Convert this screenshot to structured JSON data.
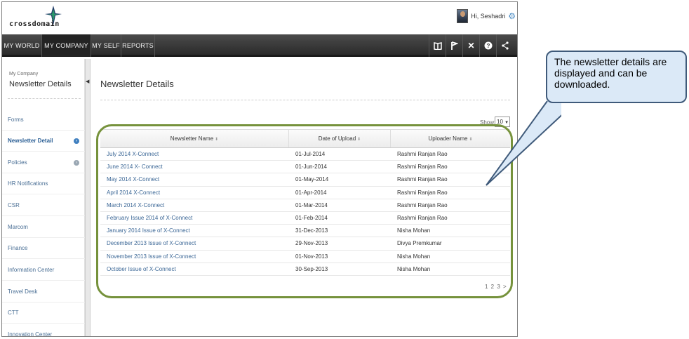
{
  "header": {
    "logo_text": "crossdomain",
    "greeting": "Hi, Seshadri"
  },
  "nav": {
    "items": [
      {
        "label": "MY WORLD"
      },
      {
        "label": "MY COMPANY"
      },
      {
        "label": "MY SELF"
      },
      {
        "label": "REPORTS"
      }
    ],
    "active": "MY COMPANY",
    "icons": [
      "book-icon",
      "flag-icon",
      "tools-icon",
      "help-icon",
      "share-icon"
    ]
  },
  "sidebar": {
    "section": "My Company",
    "title": "Newsletter Details",
    "items": [
      {
        "label": "Forms"
      },
      {
        "label": "Newsletter Detail"
      },
      {
        "label": "Policies"
      },
      {
        "label": "HR Notifications"
      },
      {
        "label": "CSR"
      },
      {
        "label": "Marcom"
      },
      {
        "label": "Finance"
      },
      {
        "label": "Information Center"
      },
      {
        "label": "Travel Desk"
      },
      {
        "label": "CTT"
      },
      {
        "label": "Innovation Center"
      }
    ]
  },
  "main": {
    "title": "Newsletter Details",
    "show_label": "Show:",
    "show_value": "10",
    "columns": [
      "Newsletter Name",
      "Date of Upload",
      "Uploader Name"
    ],
    "rows": [
      {
        "name": "July 2014 X-Connect",
        "date": "01-Jul-2014",
        "uploader": "Rashmi Ranjan Rao"
      },
      {
        "name": "June 2014 X- Connect",
        "date": "01-Jun-2014",
        "uploader": "Rashmi Ranjan Rao"
      },
      {
        "name": "May 2014 X-Connect",
        "date": "01-May-2014",
        "uploader": "Rashmi Ranjan Rao"
      },
      {
        "name": "April 2014 X-Connect",
        "date": "01-Apr-2014",
        "uploader": "Rashmi Ranjan Rao"
      },
      {
        "name": "March 2014 X-Connect",
        "date": "01-Mar-2014",
        "uploader": "Rashmi Ranjan Rao"
      },
      {
        "name": "February Issue 2014 of X-Connect",
        "date": "01-Feb-2014",
        "uploader": "Rashmi Ranjan Rao"
      },
      {
        "name": "January 2014 Issue of X-Connect",
        "date": "31-Dec-2013",
        "uploader": "Nisha Mohan"
      },
      {
        "name": "December 2013 Issue of X-Connect",
        "date": "29-Nov-2013",
        "uploader": "Divya Premkumar"
      },
      {
        "name": "November 2013 Issue of X-Connect",
        "date": "01-Nov-2013",
        "uploader": "Nisha Mohan"
      },
      {
        "name": "October Issue of X-Connect",
        "date": "30-Sep-2013",
        "uploader": "Nisha Mohan"
      }
    ],
    "pager": "1 2 3 >"
  },
  "callout": {
    "text": "The newsletter details are displayed and can be downloaded."
  },
  "colors": {
    "highlight": "#76923c",
    "callout_fill": "#dbe9f7",
    "callout_border": "#3f5a7a",
    "navbar": "#333333",
    "link": "#3b6796"
  }
}
